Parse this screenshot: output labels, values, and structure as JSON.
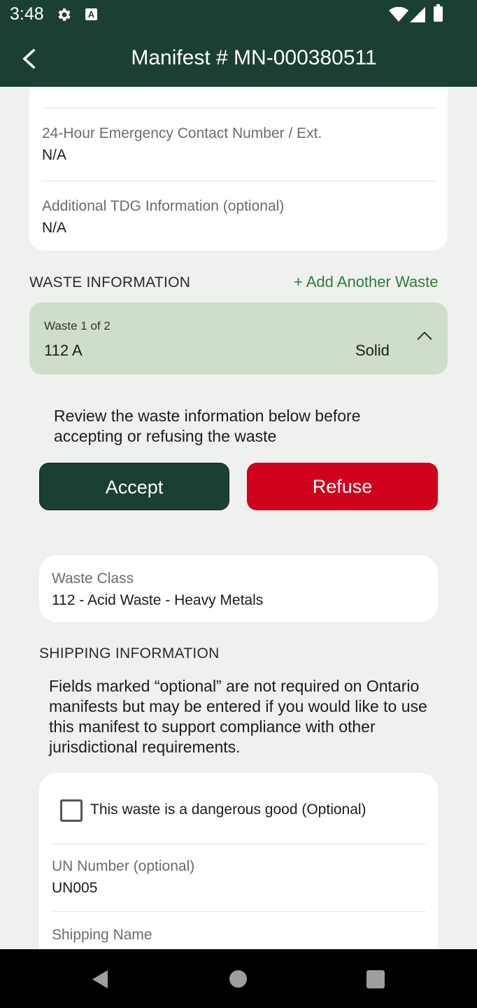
{
  "status_bar": {
    "time": "3:48",
    "a_badge": "A",
    "icons": [
      "gear-icon",
      "a-badge-icon",
      "wifi-icon",
      "signal-icon",
      "battery-icon"
    ]
  },
  "app_bar": {
    "title": "Manifest # MN-000380511",
    "back_icon": "chevron-left-icon",
    "background": "#1b3f33"
  },
  "contact_card": {
    "fields": [
      {
        "label": "24-Hour Emergency Contact Number / Ext.",
        "value": "N/A"
      },
      {
        "label": "Additional TDG Information (optional)",
        "value": "N/A"
      }
    ]
  },
  "waste_section": {
    "title": "WASTE INFORMATION",
    "add_label": "+ Add Another Waste",
    "accent": "#2f7d3a"
  },
  "waste_header": {
    "count": "Waste 1 of 2",
    "code": "112 A",
    "state": "Solid",
    "expand_icon": "chevron-up-icon",
    "background": "#cfdecb"
  },
  "review_text": "Review the waste information below before accepting or refusing the waste",
  "buttons": {
    "accept": "Accept",
    "refuse": "Refuse",
    "accept_color": "#1b3f33",
    "refuse_color": "#d0021b"
  },
  "waste_class": {
    "label": "Waste Class",
    "value": "112 - Acid Waste - Heavy Metals"
  },
  "shipping": {
    "title": "SHIPPING INFORMATION",
    "notice": "Fields marked “optional” are not required on Ontario manifests but may be entered if you would like to use this manifest to support compliance with other jurisdictional requirements.",
    "dangerous_good_label": "This waste is a dangerous good (Optional)",
    "dangerous_good_checked": false,
    "un_number_label": "UN Number (optional)",
    "un_number_value": "UN005",
    "shipping_name_label": "Shipping Name"
  },
  "nav_bar": {
    "icons": [
      "nav-back-icon",
      "nav-home-icon",
      "nav-recents-icon"
    ]
  }
}
